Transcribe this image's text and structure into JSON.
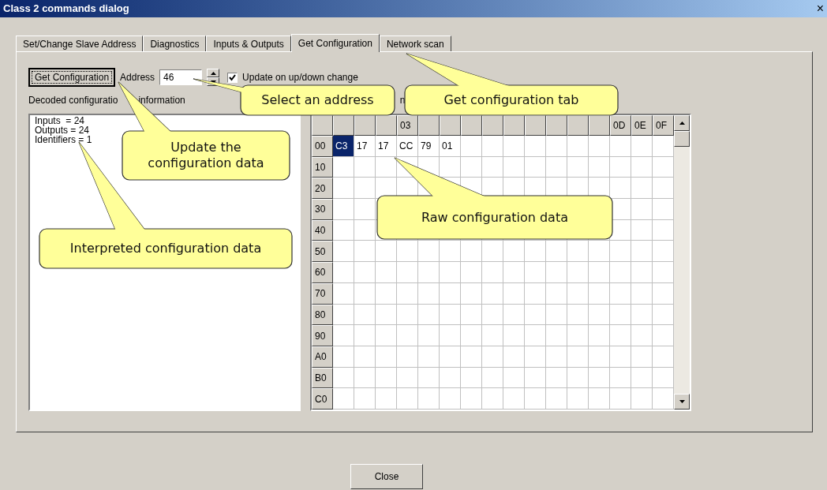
{
  "window": {
    "title": "Class 2 commands dialog",
    "close_glyph": "×"
  },
  "tabs": [
    {
      "label": "Set/Change Slave Address",
      "selected": false
    },
    {
      "label": "Diagnostics",
      "selected": false
    },
    {
      "label": "Inputs & Outputs",
      "selected": false
    },
    {
      "label": "Get Configuration",
      "selected": true
    },
    {
      "label": "Network scan",
      "selected": false
    }
  ],
  "get_button": "Get Configuration",
  "address": {
    "label": "Address",
    "value": "46"
  },
  "update_checkbox": {
    "label": "Update on up/down change",
    "checked": true
  },
  "decoded_label": {
    "before": "Decoded configuratio",
    "after": "information"
  },
  "raw_label_fragment": "n",
  "decoded_lines": [
    "Inputs  = 24",
    "Outputs = 24",
    "Identifiers = 1"
  ],
  "grid": {
    "columns": [
      {},
      {},
      {},
      {
        "label": "03"
      },
      {},
      {},
      {},
      {},
      {},
      {},
      {},
      {},
      {},
      {
        "label": "0D"
      },
      {
        "label": "0E"
      },
      {
        "label": "0F"
      }
    ],
    "rows": [
      {
        "label": "00",
        "cells": [
          {
            "value": "C3",
            "selected": true
          },
          {
            "value": "17",
            "selected": false
          },
          {
            "value": "17",
            "selected": false
          },
          {
            "value": "CC",
            "selected": false
          },
          {
            "value": "79",
            "selected": false
          },
          {
            "value": "01",
            "selected": false
          }
        ]
      },
      {
        "label": "10"
      },
      {
        "label": "20"
      },
      {
        "label": "30"
      },
      {
        "label": "40"
      },
      {
        "label": "50"
      },
      {
        "label": "60"
      },
      {
        "label": "70"
      },
      {
        "label": "80"
      },
      {
        "label": "90"
      },
      {
        "label": "A0"
      },
      {
        "label": "B0"
      },
      {
        "label": "C0"
      }
    ]
  },
  "close_button": "Close",
  "callouts": [
    "Select an address",
    "Get configuration tab",
    "Update the configuration data",
    "Interpreted configuration data",
    "Raw configuration data"
  ]
}
